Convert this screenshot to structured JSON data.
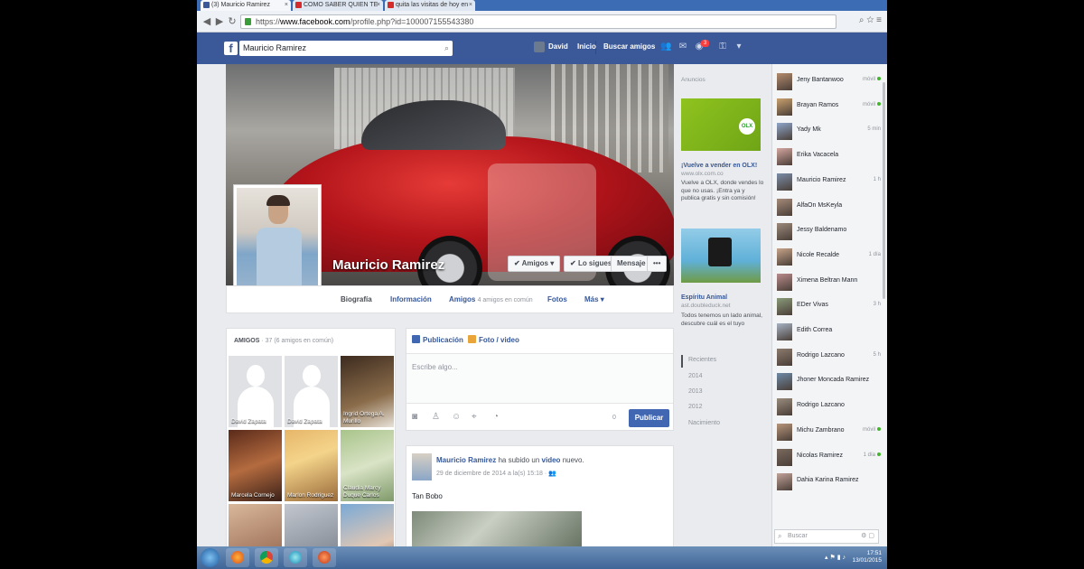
{
  "browser": {
    "tabs": [
      {
        "label": "(3) Mauricio Ramirez"
      },
      {
        "label": "COMO SABER QUIEN TE"
      },
      {
        "label": "quita las visitas de hoy en"
      }
    ],
    "url_prefix": "https://",
    "url_host": "www.facebook.com",
    "url_path": "/profile.php?id=100007155543380"
  },
  "fb_header": {
    "logo": "f",
    "search_value": "Mauricio Ramirez",
    "user_name": "David",
    "home": "Inicio",
    "find_friends": "Buscar amigos",
    "notifications_count": "3"
  },
  "profile": {
    "name": "Mauricio Ramirez",
    "btn_friends": "Amigos",
    "btn_following": "Lo sigues",
    "btn_message": "Mensaje",
    "btn_more": "•••",
    "tabs": {
      "timeline": "Biografía",
      "info": "Información",
      "friends": "Amigos",
      "friends_sub": "4 amigos en común",
      "photos": "Fotos",
      "more": "Más"
    }
  },
  "friends_panel": {
    "title": "AMIGOS",
    "subtitle": "· 37 (6 amigos en común)",
    "items": [
      {
        "name": "David Zapata"
      },
      {
        "name": "David Zapata"
      },
      {
        "name": "Ingrid Ortega A. Murillo"
      },
      {
        "name": "Marcela Cornejo"
      },
      {
        "name": "Marlon Rodriguez"
      },
      {
        "name": "Claudia Marcy Duque Carlos"
      },
      {
        "name": ""
      },
      {
        "name": ""
      },
      {
        "name": ""
      }
    ]
  },
  "composer": {
    "tab_post": "Publicación",
    "tab_photo": "Foto / video",
    "placeholder": "Escribe algo...",
    "publish": "Publicar",
    "counter": "0"
  },
  "post": {
    "author": "Mauricio Ramirez",
    "action": "ha subido un",
    "action_obj": "video",
    "action_suffix": "nuevo.",
    "meta": "29 de diciembre de 2014 a la(s) 15:18 · ",
    "text": "Tan Bobo"
  },
  "ads": {
    "header": "Anuncios",
    "ad1_title": "¡Vuelve a vender en OLX!",
    "ad1_url": "www.olx.com.co",
    "ad1_body": "Vuelve a OLX, donde vendes lo que no usas. ¡Entra ya y publica gratis y sin comisión!",
    "ad1_logo": "OLX",
    "ad2_title": "Espíritu Animal",
    "ad2_url": "ast.doubleduck.net",
    "ad2_body": "Todos tenemos un lado animal, descubre cuál es el tuyo",
    "years": [
      "Recientes",
      "2014",
      "2013",
      "2012",
      "Nacimiento"
    ]
  },
  "chat": {
    "items": [
      {
        "name": "Jeny Bantanwoo",
        "status": "móvil",
        "online": true
      },
      {
        "name": "Brayan Ramos",
        "status": "móvil",
        "online": true
      },
      {
        "name": "Yady Mk",
        "status": "5 min",
        "online": false
      },
      {
        "name": "Erika Vacacela",
        "status": "",
        "online": false
      },
      {
        "name": "Mauricio Ramirez",
        "status": "1 h",
        "online": false
      },
      {
        "name": "AlfaOn MsKeyla",
        "status": "",
        "online": false
      },
      {
        "name": "Jessy Baldenamo",
        "status": "",
        "online": false
      },
      {
        "name": "Nicole Recalde",
        "status": "1 día",
        "online": false
      },
      {
        "name": "Ximena Beltran Mann",
        "status": "",
        "online": false
      },
      {
        "name": "EDer Vivas",
        "status": "3 h",
        "online": false
      },
      {
        "name": "Edith Correa",
        "status": "",
        "online": false
      },
      {
        "name": "Rodrigo Lazcano",
        "status": "5 h",
        "online": false
      },
      {
        "name": "Jhoner Moncada Ramirez",
        "status": "",
        "online": false
      },
      {
        "name": "Rodrigo Lazcano",
        "status": "",
        "online": false
      },
      {
        "name": "Michu Zambrano",
        "status": "móvil",
        "online": true
      },
      {
        "name": "Nicolas Ramirez",
        "status": "1 día",
        "online": true
      },
      {
        "name": "Dahia Karina Ramirez",
        "status": "",
        "online": false
      }
    ],
    "search_placeholder": "Buscar"
  },
  "taskbar": {
    "time": "17:51",
    "date": "13/01/2015"
  }
}
